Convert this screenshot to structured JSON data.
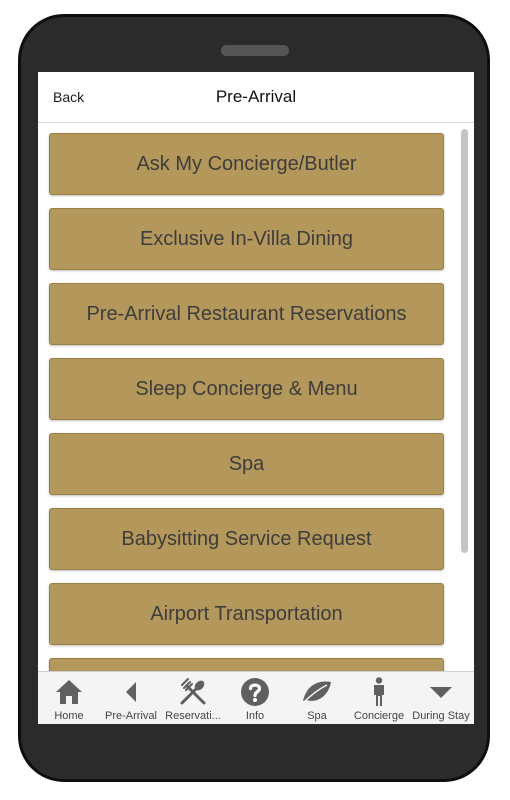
{
  "header": {
    "back_label": "Back",
    "title": "Pre-Arrival"
  },
  "menu": {
    "items": [
      {
        "label": "Ask My Concierge/Butler"
      },
      {
        "label": "Exclusive In-Villa Dining"
      },
      {
        "label": "Pre-Arrival Restaurant Reservations"
      },
      {
        "label": "Sleep Concierge & Menu"
      },
      {
        "label": "Spa"
      },
      {
        "label": "Babysitting Service Request"
      },
      {
        "label": "Airport Transportation"
      }
    ],
    "button_color": "#b4985b"
  },
  "tabs": [
    {
      "label": "Home",
      "icon": "home-icon"
    },
    {
      "label": "Pre-Arrival",
      "icon": "triangle-left-icon"
    },
    {
      "label": "Reservati...",
      "icon": "utensils-icon"
    },
    {
      "label": "Info",
      "icon": "question-icon"
    },
    {
      "label": "Spa",
      "icon": "leaf-icon"
    },
    {
      "label": "Concierge",
      "icon": "person-icon"
    },
    {
      "label": "During Stay",
      "icon": "triangle-down-icon"
    }
  ]
}
